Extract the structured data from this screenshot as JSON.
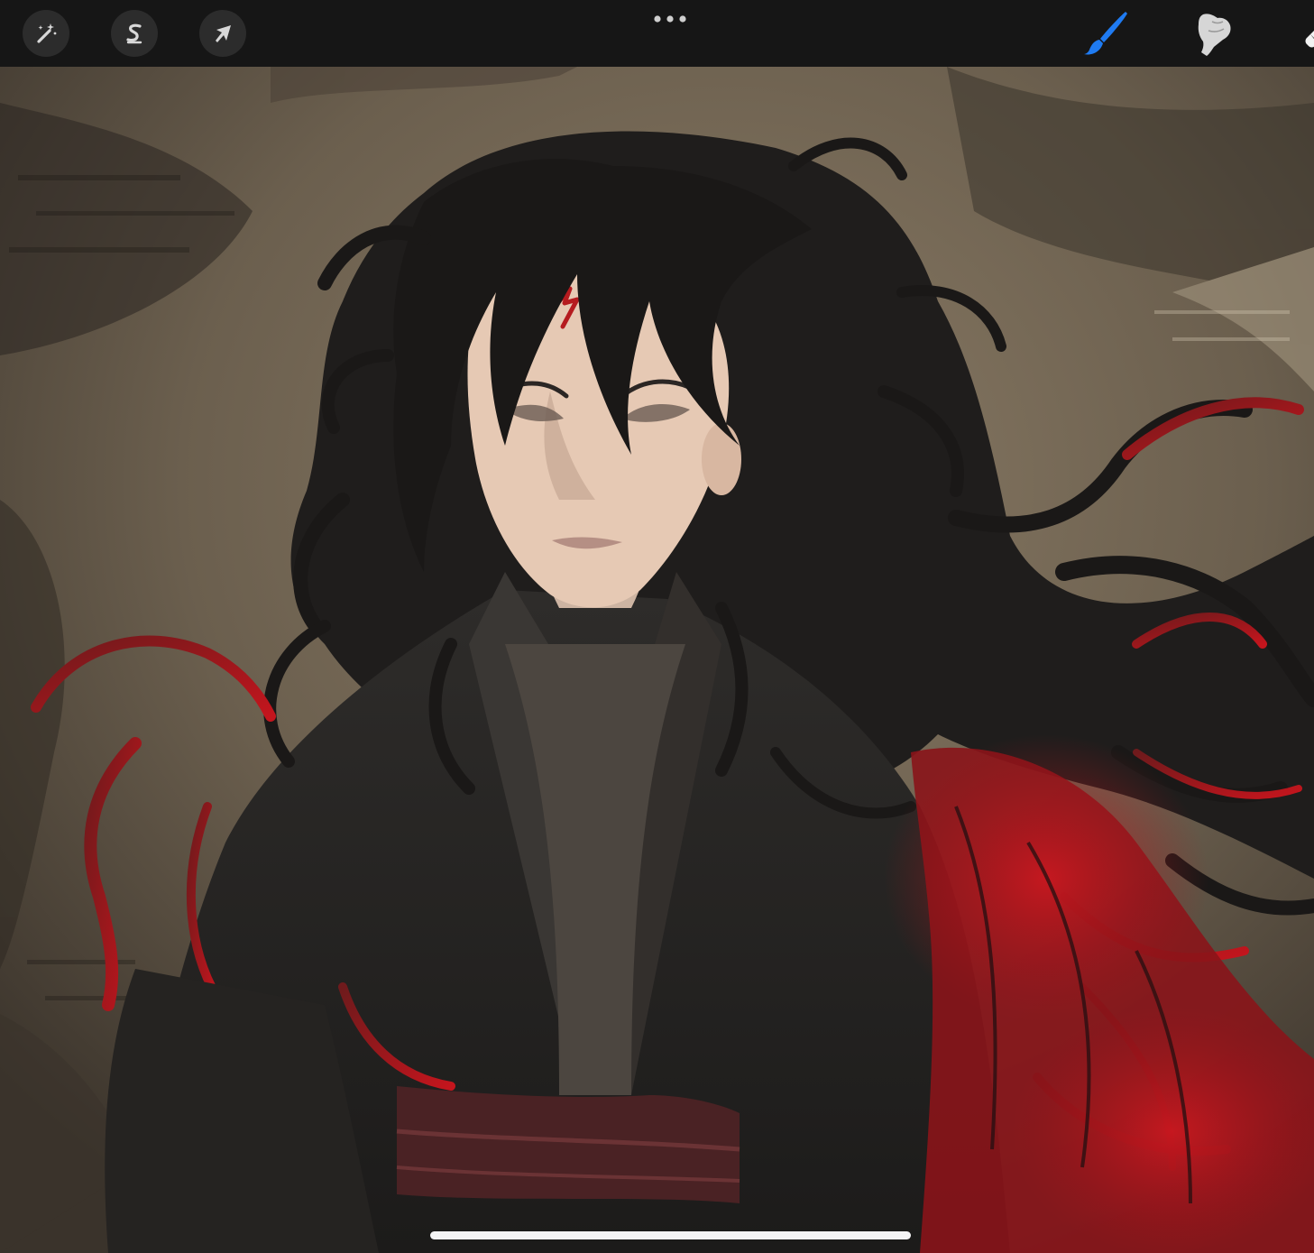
{
  "app": {
    "toolbar_left": {
      "adjustments_icon": "magic-wand-icon",
      "selection_icon": "selection-s-icon",
      "transform_icon": "cursor-arrow-icon"
    },
    "toolbar_center": {
      "more_icon": "ellipsis-icon"
    },
    "toolbar_right": {
      "brush_icon": "brush-icon",
      "smudge_icon": "smudge-finger-icon",
      "eraser_icon": "eraser-icon"
    }
  },
  "colors": {
    "toolbar_bg": "#161616",
    "button_bg": "#2c2c2c",
    "icon_light": "#d8d8d8",
    "brush_active": "#1f7bf2",
    "canvas_bg": "#6f6352",
    "hair": "#1d1b1a",
    "robe": "#2a2826",
    "accent_red": "#c0141c",
    "skin": "#e6c9b4"
  },
  "canvas": {
    "artwork": "painted-character-illustration"
  }
}
